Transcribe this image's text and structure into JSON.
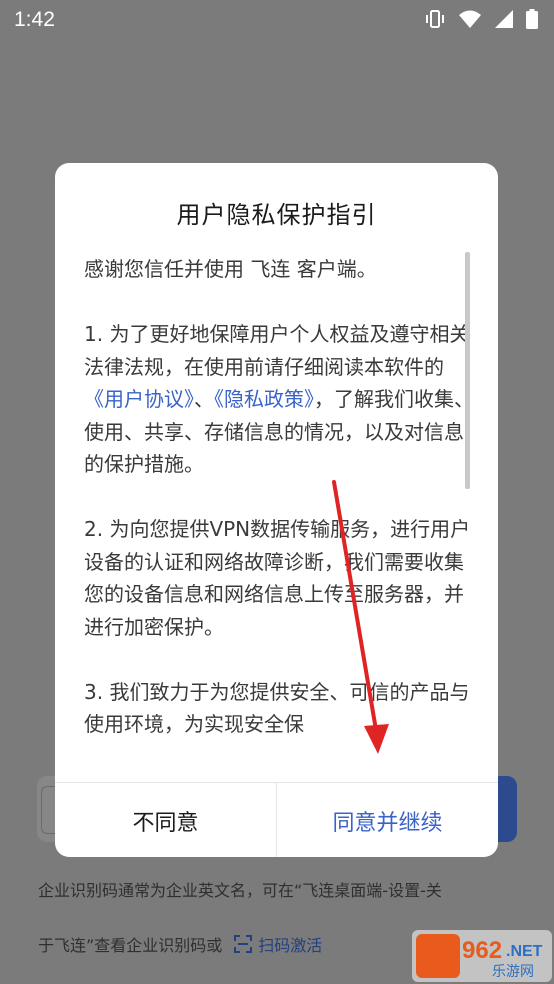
{
  "status_bar": {
    "time": "1:42",
    "icons": [
      "vibrate-icon",
      "wifi-icon",
      "signal-icon",
      "battery-icon"
    ]
  },
  "background": {
    "hint_line1": "企业识别码通常为企业英文名，可在“飞连桌面端-设置-关",
    "hint_line2": "于飞连”查看企业识别码或",
    "scan_link": "扫码激活"
  },
  "dialog": {
    "title": "用户隐私保护指引",
    "intro": "感谢您信任并使用 飞连 客户端。",
    "section1": {
      "before": "1. 为了更好地保障用户个人权益及遵守相关法律法规，在使用前请仔细阅读本软件的",
      "link_user_agreement": "《用户协议》",
      "between": "、",
      "link_privacy_policy": "《隐私政策》",
      "after": "，了解我们收集、使用、共享、存储信息的情况，以及对信息的保护措施。"
    },
    "section2": "2. 为向您提供VPN数据传输服务，进行用户设备的认证和网络故障诊断，我们需要收集您的设备信息和网络信息上传至服务器，并进行加密保护。",
    "section3": "3. 我们致力于为您提供安全、可信的产品与使用环境，为实现安全保",
    "disagree_label": "不同意",
    "agree_label": "同意并继续"
  },
  "watermark": {
    "number": "962",
    "net": ".NET",
    "site": "乐游网"
  },
  "colors": {
    "link": "#3a63c8",
    "arrow": "#e02424",
    "overlay": "#7b7b7b"
  }
}
